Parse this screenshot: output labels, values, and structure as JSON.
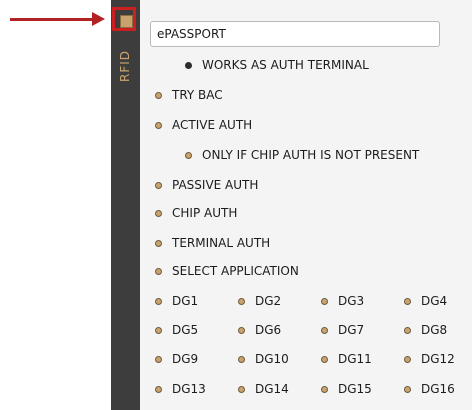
{
  "side_panel": {
    "label": "RFID"
  },
  "application_input": {
    "value": "ePASSPORT"
  },
  "options": {
    "works_as_auth_terminal": "WORKS AS AUTH TERMINAL",
    "try_bac": "TRY BAC",
    "active_auth": "ACTIVE AUTH",
    "only_if_chip_auth_not_present": "ONLY IF CHIP AUTH IS NOT PRESENT",
    "passive_auth": "PASSIVE AUTH",
    "chip_auth": "CHIP AUTH",
    "terminal_auth": "TERMINAL AUTH",
    "select_application": "SELECT APPLICATION"
  },
  "data_groups": [
    "DG1",
    "DG2",
    "DG3",
    "DG4",
    "DG5",
    "DG6",
    "DG7",
    "DG8",
    "DG9",
    "DG10",
    "DG11",
    "DG12",
    "DG13",
    "DG14",
    "DG15",
    "DG16"
  ],
  "colors": {
    "accent": "#c8a36e",
    "panel_bg": "#3d3d3d",
    "highlight": "#cc1f1f"
  }
}
